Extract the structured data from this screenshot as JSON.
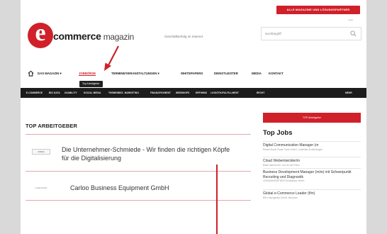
{
  "header": {
    "promo_button": "ALLE MAGAZINE UND LÖSUNGSPARTNER",
    "top_mini": "Login",
    "logo_letter": "e",
    "logo_word": "commerce",
    "logo_suffix": " magazin",
    "tagline": "Geschäftserfolg im Internet",
    "search_placeholder": "Suchbegriff"
  },
  "nav": {
    "items": [
      {
        "label": "DAS MAGAZIN ▾"
      },
      {
        "label": "JOBBÖRSE"
      },
      {
        "label": "TERMINE/VERANSTALTUNGEN ▾"
      },
      {
        "label": "WHITEPAPERS"
      },
      {
        "label": "DIENSTLEISTER"
      },
      {
        "label": "MEDIA"
      },
      {
        "label": "KONTAKT"
      }
    ],
    "tooltip": "Top Arbeitgeber"
  },
  "categories": [
    "E-COMMERCE",
    "BIG DATA",
    "USABILITY",
    "SOCIAL MEDIA",
    "THEMENBEZ. MARKETING",
    "FINANZ/PAYMENT",
    "WEBSHOPS",
    "ERP/WMS",
    "LOGISTIK/FULFILLMENT",
    "RECHT",
    "MEHR"
  ],
  "main": {
    "section_title": "TOP ARBEITGEBER",
    "jobs": [
      {
        "logo": "FIRMA",
        "title": "Die Unternehmer-Schmiede - Wir finden die richtigen Köpfe für die Digitalisierung"
      },
      {
        "logo": "CARLOFON",
        "title": "Carloo Business Equipment GmbH"
      }
    ]
  },
  "sidebar": {
    "button": "TOP Arbeitgeber",
    "title": "Top Jobs",
    "jobs": [
      {
        "title": "Digital Communication Manager (m",
        "company": "Robert Bosch Power Tools GmbH, Leinfelden-Echterdingen"
      },
      {
        "title": "Cloud Webentwickler/in",
        "company": "Blank Internet AG, Linz an der Rhein"
      },
      {
        "title": "Business Development Manager (m/w) mit Schwerpunkt Recruiting und Diagnostik",
        "company": "LEHMANNPARTNER Schulklasse, Berlin"
      },
      {
        "title": "Global e-Commerce Leader (f/m)",
        "company": "BSH Hausgeräte GmbH, München"
      }
    ]
  },
  "colors": {
    "accent": "#d0202a",
    "catbar": "#1c1c1c",
    "background": "#d9d9d9"
  }
}
